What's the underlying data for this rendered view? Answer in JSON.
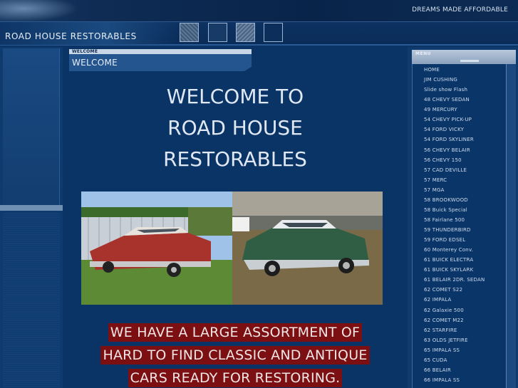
{
  "header": {
    "tagline": "DREAMS MADE AFFORDABLE",
    "site_title": "ROAD HOUSE RESTORABLES"
  },
  "welcome_tab": {
    "small_label": "WELCOME",
    "big_label": "WELCOME"
  },
  "main": {
    "heading_lines": [
      "WELCOME TO",
      "ROAD HOUSE",
      "RESTORABLES"
    ],
    "promo_lines": [
      "WE HAVE A LARGE ASSORTMENT OF",
      "HARD TO FIND CLASSIC AND ANTIQUE",
      "CARS READY FOR RESTORING."
    ]
  },
  "menu": {
    "label": "MENU",
    "items": [
      "HOME",
      "JIM CUSHING",
      "Slide show Flash",
      "48 CHEVY SEDAN",
      "49 MERCURY",
      "54 CHEVY PICK-UP",
      "54 FORD VICKY",
      "54 FORD SKYLINER",
      "56 CHEVY BELAIR",
      "56 CHEVY 150",
      "57 CAD DEVILLE",
      "57 MERC",
      "57 MGA",
      "58 BROOKWOOD",
      "58 Buick Special",
      "58 Fairlane 500",
      "59 THUNDERBIRD",
      "59 FORD EDSEL",
      "60 Monterey Conv.",
      "61 BUICK ELECTRA",
      "61 BUICK SKYLARK",
      "61 BELAIR 2DR. SEDAN",
      "62 COMET S22",
      "62 IMPALA",
      "62 Galaxie 500",
      "62 COMET M22",
      "62 STARFIRE",
      "63 OLDS JETFIRE",
      "65 IMPALA SS",
      "65 CUDA",
      "66 BELAIR",
      "66 IMPALA SS"
    ]
  },
  "colors": {
    "background": "#0a3466",
    "promo_highlight": "#7b0f12",
    "menu_text": "#cfdcec"
  }
}
